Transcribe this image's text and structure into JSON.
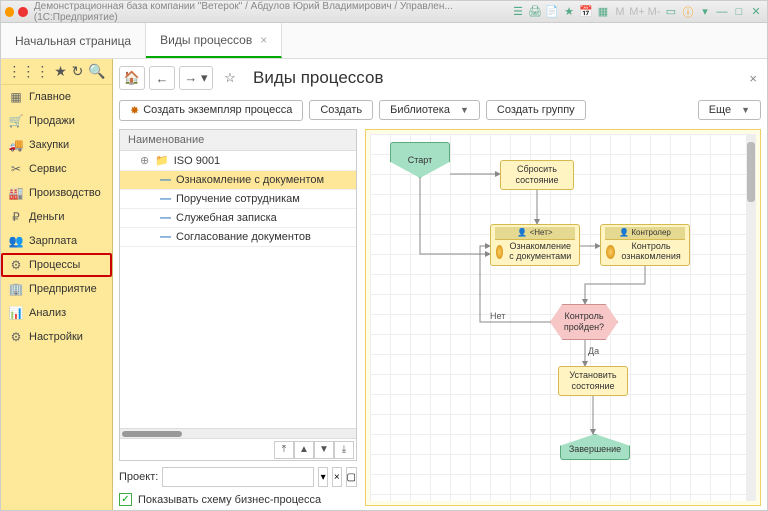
{
  "window_title": "Демонстрационная база компании \"Ветерок\" / Абдулов Юрий Владимирович / Управлен... (1С:Предприятие)",
  "tabs": {
    "start": "Начальная страница",
    "processes": "Виды процессов"
  },
  "page_title": "Виды процессов",
  "toolbar": {
    "create_instance": "Создать экземпляр процесса",
    "create": "Создать",
    "library": "Библиотека",
    "create_group": "Создать группу",
    "more": "Еще"
  },
  "sidebar": {
    "items": [
      "Главное",
      "Продажи",
      "Закупки",
      "Сервис",
      "Производство",
      "Деньги",
      "Зарплата",
      "Процессы",
      "Предприятие",
      "Анализ",
      "Настройки"
    ]
  },
  "tree": {
    "header": "Наименование",
    "items": [
      {
        "label": "ISO 9001"
      },
      {
        "label": "Ознакомление с документом"
      },
      {
        "label": "Поручение сотрудникам"
      },
      {
        "label": "Служебная записка"
      },
      {
        "label": "Согласование документов"
      }
    ]
  },
  "project_label": "Проект:",
  "project_value": "",
  "show_schema": "Показывать схему бизнес-процесса",
  "diagram": {
    "start": "Старт",
    "reset": "Сбросить состояние",
    "none_header": "<Нет>",
    "familiarize": "Ознакомление с документами",
    "controller_header": "Контролер",
    "control_fam": "Контроль ознакомления",
    "cond": "Контроль пройден?",
    "no": "Нет",
    "yes": "Да",
    "set_state": "Установить состояние",
    "end": "Завершение"
  }
}
